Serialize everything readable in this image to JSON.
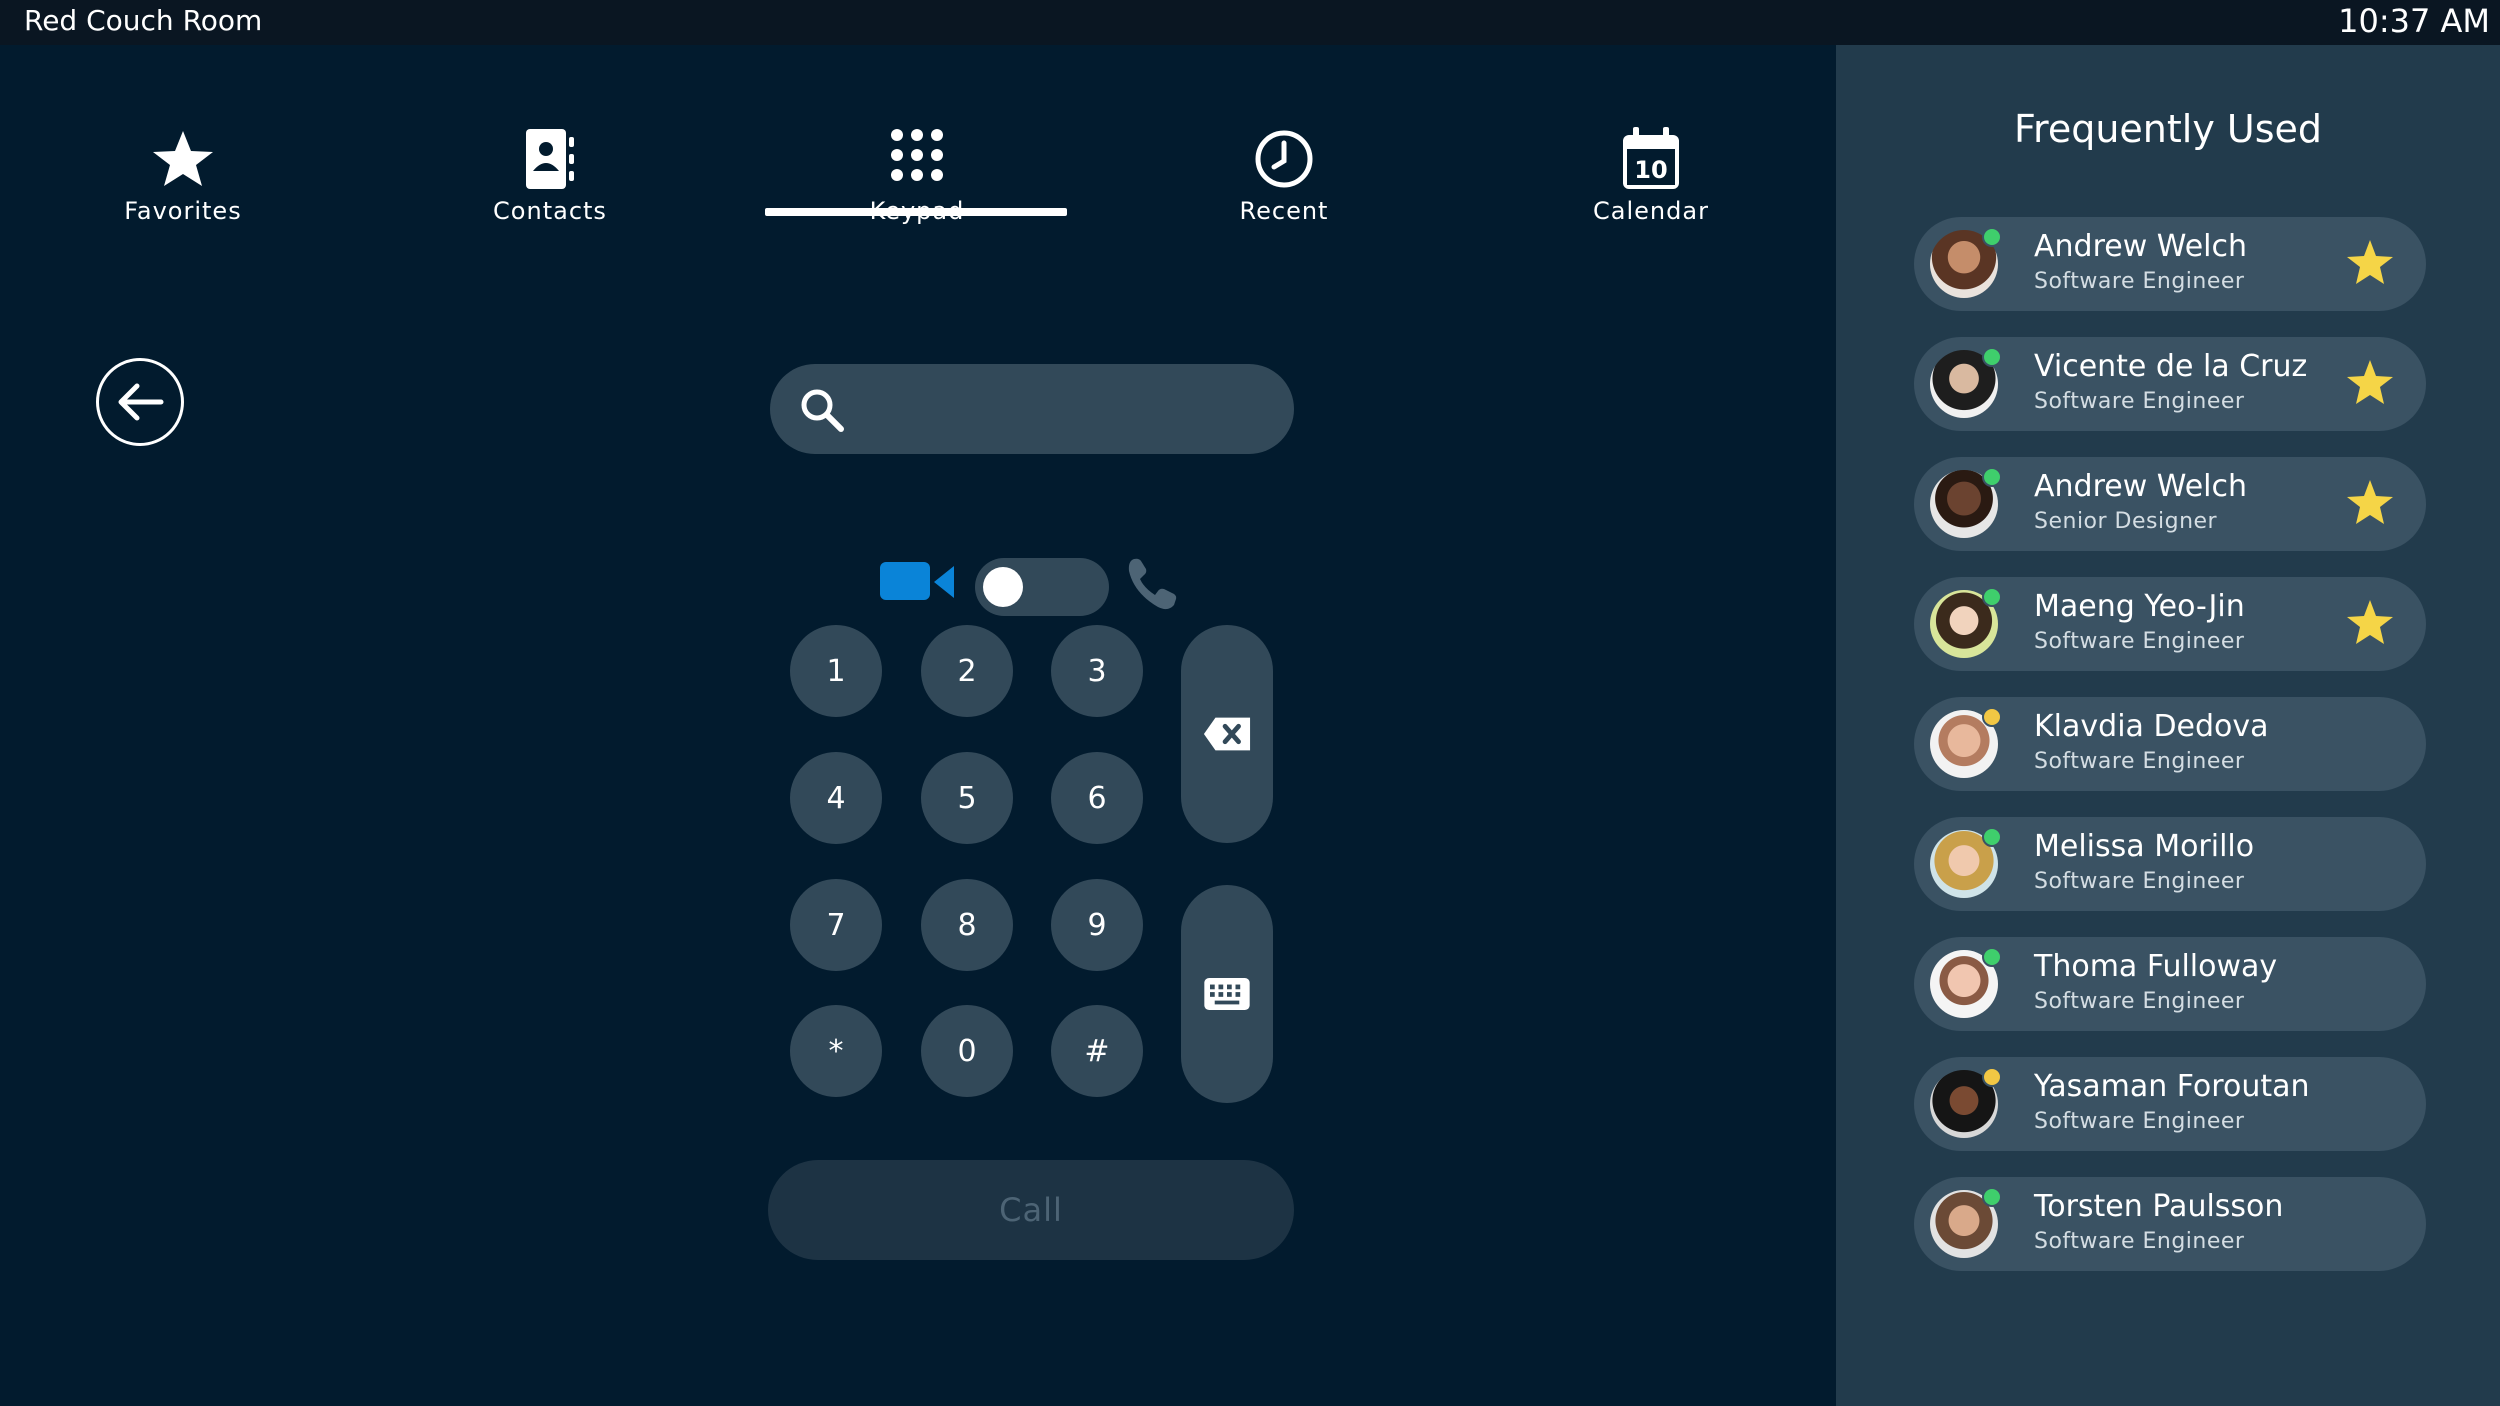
{
  "status_bar": {
    "room_name": "Red Couch Room",
    "time": "10:37 AM"
  },
  "tabs": [
    {
      "label": "Favorites",
      "icon": "star-icon"
    },
    {
      "label": "Contacts",
      "icon": "contacts-card-icon"
    },
    {
      "label": "Keypad",
      "icon": "keypad-grid-icon",
      "active": true
    },
    {
      "label": "Recent",
      "icon": "clock-icon"
    },
    {
      "label": "Calendar",
      "icon": "calendar-icon",
      "badge": "10"
    }
  ],
  "search": {
    "value": "",
    "placeholder": ""
  },
  "call_mode": {
    "mode": "video"
  },
  "keypad": {
    "keys": [
      "1",
      "2",
      "3",
      "4",
      "5",
      "6",
      "7",
      "8",
      "9",
      "*",
      "0",
      "#"
    ],
    "side_keys": [
      "backspace-icon",
      "keyboard-icon"
    ]
  },
  "call_button": {
    "label": "Call"
  },
  "side_panel": {
    "title": "Frequently Used",
    "contacts": [
      {
        "name": "Andrew Welch",
        "title": "Software Engineer",
        "favorite": true,
        "presence": "available"
      },
      {
        "name": "Vicente de la Cruz",
        "title": "Software Engineer",
        "favorite": true,
        "presence": "available"
      },
      {
        "name": "Andrew Welch",
        "title": "Senior Designer",
        "favorite": true,
        "presence": "available"
      },
      {
        "name": "Maeng Yeo-Jin",
        "title": "Software Engineer",
        "favorite": true,
        "presence": "available"
      },
      {
        "name": "Klavdia Dedova",
        "title": "Software Engineer",
        "favorite": false,
        "presence": "away"
      },
      {
        "name": "Melissa Morillo",
        "title": "Software Engineer",
        "favorite": false,
        "presence": "available"
      },
      {
        "name": "Thoma Fulloway",
        "title": "Software Engineer",
        "favorite": false,
        "presence": "available"
      },
      {
        "name": "Yasaman Foroutan",
        "title": "Software Engineer",
        "favorite": false,
        "presence": "away"
      },
      {
        "name": "Torsten Paulsson",
        "title": "Software Engineer",
        "favorite": false,
        "presence": "available"
      }
    ]
  },
  "colors": {
    "background": "#021b2e",
    "side_panel": "#223b4c",
    "accent_blue": "#0a84d8",
    "star_yellow": "#f5d547",
    "presence_available": "#3fcf6c",
    "presence_away": "#f2c744"
  }
}
